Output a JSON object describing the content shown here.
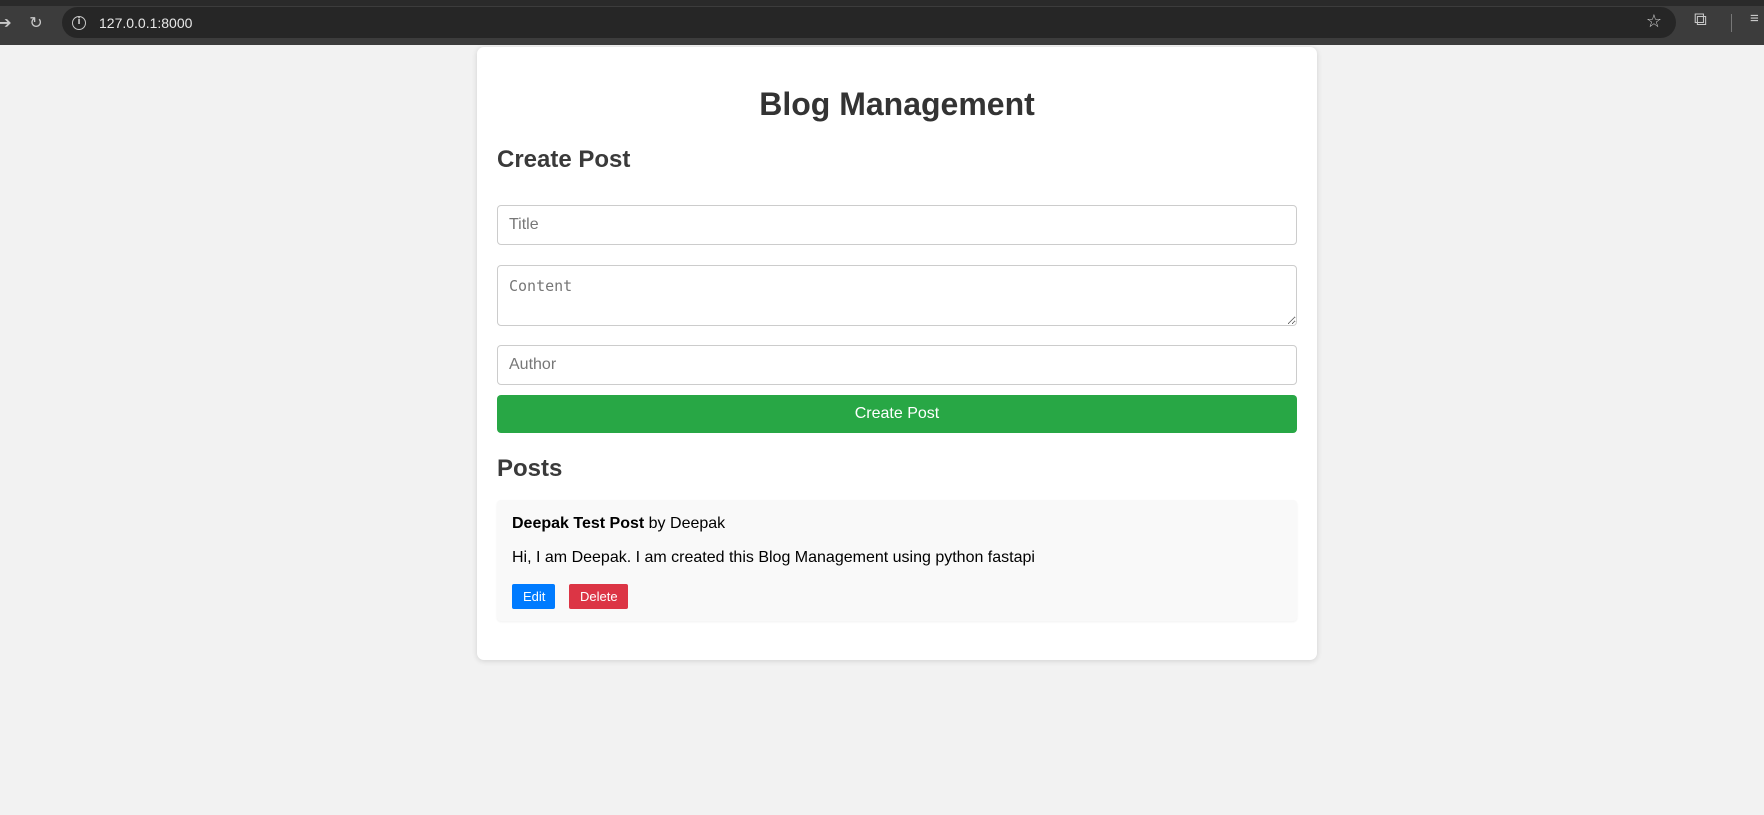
{
  "browser": {
    "url": "127.0.0.1:8000",
    "back_icon": "back-arrow-icon",
    "reload_icon": "reload-icon",
    "info_icon": "site-info-icon",
    "bookmark_icon": "star-icon",
    "extensions_icon": "puzzle-icon",
    "menu_icon": "menu-icon"
  },
  "page": {
    "title": "Blog Management",
    "create_section": {
      "heading": "Create Post",
      "title_placeholder": "Title",
      "content_placeholder": "Content",
      "author_placeholder": "Author",
      "title_value": "",
      "content_value": "",
      "author_value": "",
      "submit_label": "Create Post"
    },
    "posts_section": {
      "heading": "Posts",
      "posts": [
        {
          "title": "Deepak Test Post",
          "by_label": "by",
          "author": "Deepak",
          "content": "Hi, I am Deepak. I am created this Blog Management using python fastapi",
          "edit_label": "Edit",
          "delete_label": "Delete"
        }
      ]
    }
  },
  "colors": {
    "primary_green": "#28a745",
    "edit_blue": "#007bff",
    "delete_red": "#dc3545",
    "page_background": "#f2f2f2"
  }
}
